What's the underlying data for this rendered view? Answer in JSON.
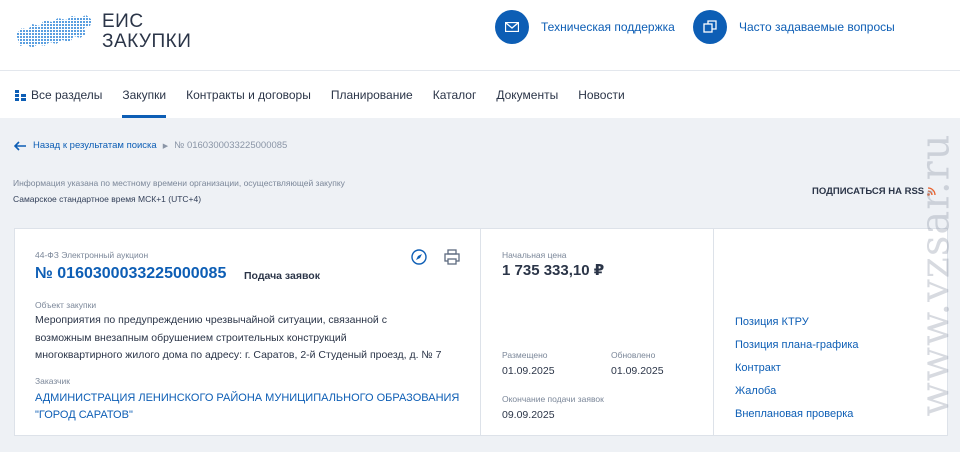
{
  "header": {
    "logo_line1": "ЕИС",
    "logo_line2": "ЗАКУПКИ",
    "support_label": "Техническая поддержка",
    "faq_label": "Часто задаваемые вопросы"
  },
  "nav": {
    "all_sections": "Все разделы",
    "items": [
      "Закупки",
      "Контракты и договоры",
      "Планирование",
      "Каталог",
      "Документы",
      "Новости"
    ],
    "active": "Закупки"
  },
  "breadcrumb": {
    "back_label": "Назад к результатам поиска",
    "current": "№ 0160300033225000085"
  },
  "timezone": {
    "note": "Информация указана по местному времени организации, осуществляющей закупку",
    "value": "Самарское стандартное время МСК+1 (UTC+4)"
  },
  "rss_label": "ПОДПИСАТЬСЯ НА RSS",
  "purchase": {
    "law_type": "44-ФЗ Электронный аукцион",
    "number": "№ 0160300033225000085",
    "stage": "Подача заявок",
    "object_label": "Объект закупки",
    "object_lines": [
      "Мероприятия по предупреждению чрезвычайной ситуации, связанной с",
      "возможным внезапным обрушением строительных конструкций",
      "многоквартирного жилого дома по адресу: г. Саратов, 2-й Студеный проезд, д. № 7"
    ],
    "customer_label": "Заказчик",
    "customer_lines": [
      "АДМИНИСТРАЦИЯ ЛЕНИНСКОГО РАЙОНА МУНИЦИПАЛЬНОГО ОБРАЗОВАНИЯ",
      "\"ГОРОД САРАТОВ\""
    ]
  },
  "pricing": {
    "start_price_label": "Начальная цена",
    "start_price": "1 735 333,10 ₽",
    "posted_label": "Размещено",
    "posted": "01.09.2025",
    "updated_label": "Обновлено",
    "updated": "01.09.2025",
    "deadline_label": "Окончание подачи заявок",
    "deadline": "09.09.2025"
  },
  "side_links": [
    "Позиция КТРУ",
    "Позиция плана-графика",
    "Контракт",
    "Жалоба",
    "Внеплановая проверка"
  ],
  "watermark": "www.vzsar.ru",
  "colors": {
    "accent": "#0d5eb5",
    "rss": "#e8612c"
  }
}
